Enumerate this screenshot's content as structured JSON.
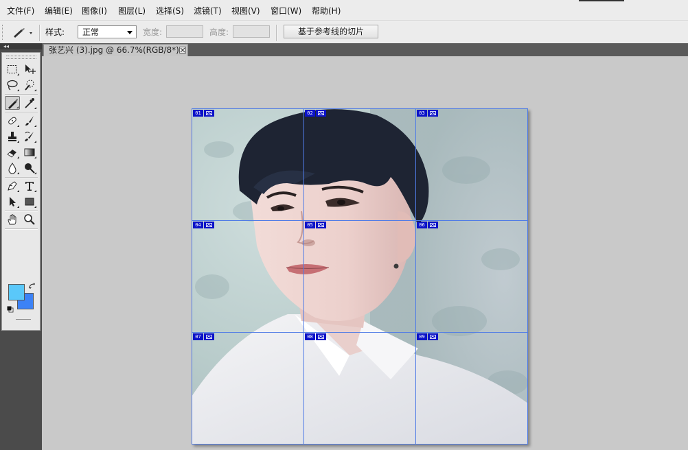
{
  "menu": {
    "items": [
      {
        "label": "文件(F)"
      },
      {
        "label": "编辑(E)"
      },
      {
        "label": "图像(I)"
      },
      {
        "label": "图层(L)"
      },
      {
        "label": "选择(S)"
      },
      {
        "label": "滤镜(T)"
      },
      {
        "label": "视图(V)"
      },
      {
        "label": "窗口(W)"
      },
      {
        "label": "帮助(H)"
      }
    ]
  },
  "options": {
    "style_label": "样式:",
    "style_value": "正常",
    "width_label": "宽度:",
    "height_label": "高度:",
    "guides_button": "基于参考线的切片"
  },
  "document": {
    "tab_title": "张艺兴 (3).jpg @ 66.7%(RGB/8*) *"
  },
  "slices": [
    {
      "label": "01"
    },
    {
      "label": "02"
    },
    {
      "label": "03"
    },
    {
      "label": "04"
    },
    {
      "label": "05"
    },
    {
      "label": "06"
    },
    {
      "label": "07"
    },
    {
      "label": "08"
    },
    {
      "label": "09"
    }
  ],
  "colors": {
    "foreground": "#5ac8fa",
    "background": "#3c82f6",
    "slice_line": "#4f7be6",
    "slice_badge": "#0b12c8"
  },
  "tools": [
    "rect-marquee-icon",
    "move-icon",
    "lasso-icon",
    "quick-select-icon",
    "slice-icon",
    "eyedropper-icon",
    "healing-brush-icon",
    "brush-icon",
    "clone-stamp-icon",
    "history-brush-icon",
    "eraser-icon",
    "gradient-icon",
    "blur-icon",
    "dodge-icon",
    "pen-icon",
    "type-icon",
    "path-select-icon",
    "rectangle-shape-icon",
    "hand-icon",
    "zoom-icon"
  ]
}
